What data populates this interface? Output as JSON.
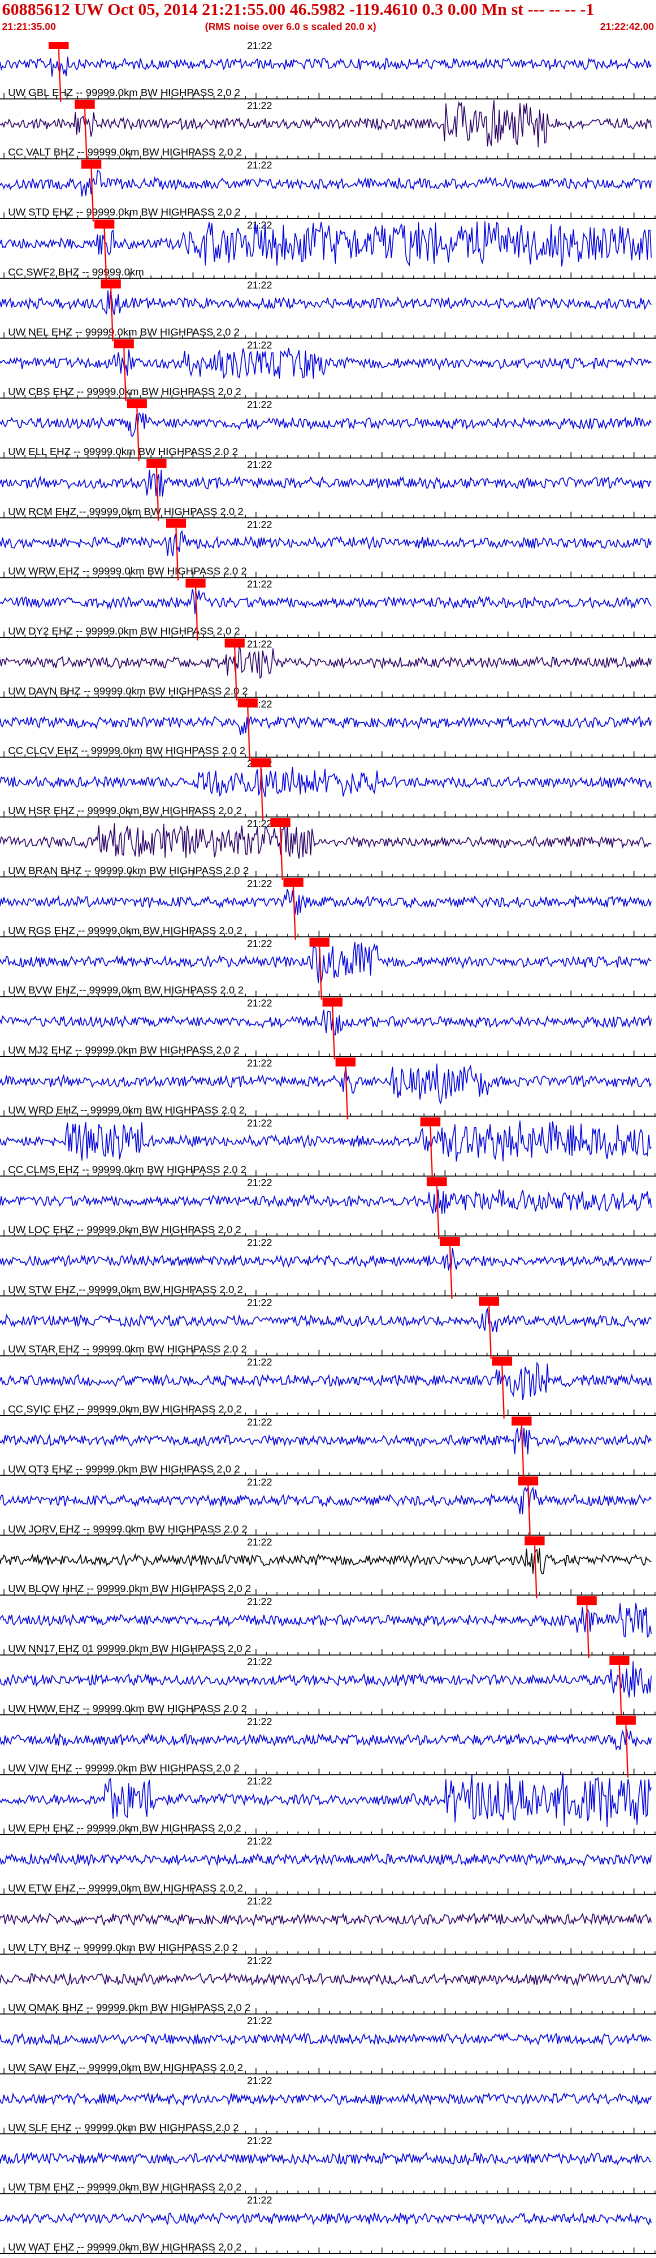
{
  "header": {
    "title": "60885612 UW Oct 05, 2014 21:21:55.00   46.5982 -119.4610  0.3 0.00 Mn st --- -- --  -1",
    "start_time": "21:21:35.00",
    "noise_note": "(RMS noise over 6.0 s scaled 20.0 x)",
    "end_time": "21:22:42.00"
  },
  "colors": {
    "text_red": "#d00000",
    "trace_blue": "#0000dd",
    "trace_dark": "#2a0066",
    "trace_black": "#000000",
    "pick_red": "#ff0000"
  },
  "time_label": "21:22",
  "traces": [
    {
      "label": "UW GBL EHZ -- 99999.0km BW  HIGHPASS  2.0  2",
      "color": "blue",
      "pick": 0.09
    },
    {
      "label": "CC VALT BHZ -- 99999.0km BW  HIGHPASS  2.0  2",
      "color": "dark",
      "pick": 0.13
    },
    {
      "label": "UW STD EHZ -- 99999.0km BW  HIGHPASS  2.0  2",
      "color": "blue",
      "pick": 0.14
    },
    {
      "label": "CC SWF2 BHZ -- 99999.0km",
      "color": "blue",
      "pick": 0.16
    },
    {
      "label": "UW NEL EHZ -- 99999.0km BW  HIGHPASS  2.0  2",
      "color": "blue",
      "pick": 0.17
    },
    {
      "label": "UW CBS EHZ -- 99999.0km BW  HIGHPASS  2.0  2",
      "color": "blue",
      "pick": 0.19
    },
    {
      "label": "UW ELL EHZ -- 99999.0km BW  HIGHPASS  2.0  2",
      "color": "blue",
      "pick": 0.21
    },
    {
      "label": "UW RCM EHZ -- 99999.0km BW  HIGHPASS  2.0  2",
      "color": "blue",
      "pick": 0.24
    },
    {
      "label": "UW WRW EHZ -- 99999.0km BW  HIGHPASS  2.0  2",
      "color": "blue",
      "pick": 0.27
    },
    {
      "label": "UW DY2 EHZ -- 99999.0km BW  HIGHPASS  2.0  2",
      "color": "blue",
      "pick": 0.3
    },
    {
      "label": "UW DAVN BHZ -- 99999.0km BW  HIGHPASS  2.0  2",
      "color": "dark",
      "pick": 0.36
    },
    {
      "label": "CC CLCV EHZ -- 99999.0km BW  HIGHPASS  2.0  2",
      "color": "blue",
      "pick": 0.38
    },
    {
      "label": "UW HSR EHZ -- 99999.0km BW  HIGHPASS  2.0  2",
      "color": "blue",
      "pick": 0.4
    },
    {
      "label": "UW BRAN BHZ -- 99999.0km BW  HIGHPASS  2.0  2",
      "color": "dark",
      "pick": 0.43
    },
    {
      "label": "UW RGS EHZ -- 99999.0km BW  HIGHPASS  2.0  2",
      "color": "blue",
      "pick": 0.45
    },
    {
      "label": "UW BVW EHZ -- 99999.0km BW  HIGHPASS  2.0  2",
      "color": "blue",
      "pick": 0.49
    },
    {
      "label": "UW MJ2 EHZ -- 99999.0km BW  HIGHPASS  2.0  2",
      "color": "blue",
      "pick": 0.51
    },
    {
      "label": "UW WRD EHZ -- 99999.0km BW  HIGHPASS  2.0  2",
      "color": "blue",
      "pick": 0.53
    },
    {
      "label": "CC CLMS EHZ -- 99999.0km BW  HIGHPASS  2.0  2",
      "color": "blue",
      "pick": 0.66
    },
    {
      "label": "UW LOC EHZ -- 99999.0km BW  HIGHPASS  2.0  2",
      "color": "blue",
      "pick": 0.67
    },
    {
      "label": "UW STW EHZ -- 99999.0km BW  HIGHPASS  2.0  2",
      "color": "blue",
      "pick": 0.69
    },
    {
      "label": "UW STAR EHZ -- 99999.0km BW  HIGHPASS  2.0  2",
      "color": "blue",
      "pick": 0.75
    },
    {
      "label": "CC SVIC EHZ -- 99999.0km BW  HIGHPASS  2.0  2",
      "color": "blue",
      "pick": 0.77
    },
    {
      "label": "UW OT3 EHZ -- 99999.0km BW  HIGHPASS  2.0  2",
      "color": "blue",
      "pick": 0.8
    },
    {
      "label": "UW JORV EHZ -- 99999.0km BW  HIGHPASS  2.0  2",
      "color": "blue",
      "pick": 0.81
    },
    {
      "label": "UW BLOW HHZ -- 99999.0km BW  HIGHPASS  2.0  2",
      "color": "black",
      "pick": 0.82
    },
    {
      "label": "UW NN17 EHZ 01 99999.0km BW  HIGHPASS  2.0  2",
      "color": "blue",
      "pick": 0.9
    },
    {
      "label": "UW HWW EHZ -- 99999.0km BW  HIGHPASS  2.0  2",
      "color": "blue",
      "pick": 0.95
    },
    {
      "label": "UW VIW EHZ -- 99999.0km BW  HIGHPASS  2.0  2",
      "color": "blue",
      "pick": 0.96
    },
    {
      "label": "UW EPH EHZ -- 99999.0km BW  HIGHPASS  2.0  2",
      "color": "blue"
    },
    {
      "label": "UW ETW EHZ -- 99999.0km BW  HIGHPASS  2.0  2",
      "color": "blue"
    },
    {
      "label": "UW LTY BHZ -- 99999.0km BW  HIGHPASS  2.0  2",
      "color": "dark"
    },
    {
      "label": "UW OMAK BHZ -- 99999.0km BW  HIGHPASS  2.0  2",
      "color": "dark"
    },
    {
      "label": "UW SAW EHZ -- 99999.0km BW  HIGHPASS  2.0  2",
      "color": "blue"
    },
    {
      "label": "UW SLF EHZ -- 99999.0km BW  HIGHPASS  2.0  2",
      "color": "blue"
    },
    {
      "label": "UW TBM EHZ -- 99999.0km BW  HIGHPASS  2.0  2",
      "color": "blue"
    },
    {
      "label": "UW WAT EHZ -- 99999.0km BW  HIGHPASS  2.0  2",
      "color": "blue"
    }
  ]
}
